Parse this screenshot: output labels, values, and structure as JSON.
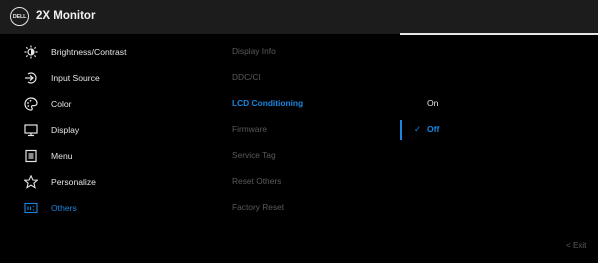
{
  "header": {
    "logo_text": "DELL",
    "title": "2X Monitor"
  },
  "menu": {
    "items": [
      {
        "label": "Brightness/Contrast",
        "icon": "brightness-icon"
      },
      {
        "label": "Input Source",
        "icon": "input-source-icon"
      },
      {
        "label": "Color",
        "icon": "color-palette-icon"
      },
      {
        "label": "Display",
        "icon": "display-icon"
      },
      {
        "label": "Menu",
        "icon": "menu-icon"
      },
      {
        "label": "Personalize",
        "icon": "star-icon"
      },
      {
        "label": "Others",
        "icon": "others-icon",
        "active": true
      }
    ]
  },
  "submenu": {
    "items": [
      {
        "label": "Display Info"
      },
      {
        "label": "DDC/CI"
      },
      {
        "label": "LCD Conditioning",
        "active": true
      },
      {
        "label": "Firmware"
      },
      {
        "label": "Service Tag"
      },
      {
        "label": "Reset Others"
      },
      {
        "label": "Factory Reset"
      }
    ]
  },
  "options": {
    "on_label": "On",
    "off_label": "Off",
    "selected": "Off",
    "check_mark": "✓"
  },
  "footer": {
    "exit_label": "Exit",
    "exit_chevron": "<"
  },
  "colors": {
    "accent": "#1a86e0",
    "header_bg": "#1c1c1c",
    "background": "#000000",
    "dim_text": "#5a5a5a"
  }
}
